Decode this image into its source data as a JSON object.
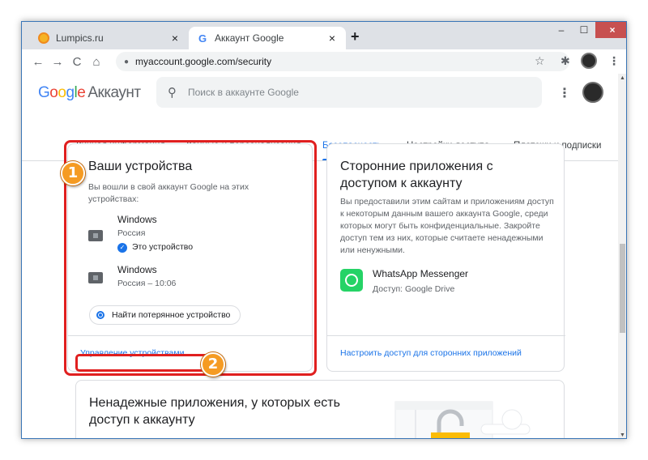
{
  "browser": {
    "tabs": [
      {
        "title": "Lumpics.ru",
        "close": "×"
      },
      {
        "title": "Аккаунт Google",
        "close": "×"
      }
    ],
    "new_tab": "+",
    "window_controls": {
      "minimize": "–",
      "maximize": "☐",
      "close": "×"
    },
    "nav": {
      "back": "←",
      "forward": "→",
      "reload": "C",
      "home": "⌂"
    },
    "url": "myaccount.google.com/security",
    "star": "☆",
    "extensions": "✱",
    "menu": "⋮"
  },
  "header": {
    "logo": {
      "G": "G",
      "o1": "o",
      "o2": "o",
      "g": "g",
      "l": "l",
      "e": "e",
      "suffix": "Аккаунт"
    },
    "search_placeholder": "Поиск в аккаунте Google",
    "apps_menu": "⋮"
  },
  "nav_tabs": [
    "Личная информация",
    "Данные и персонализация",
    "Безопасность",
    "Настройки доступа",
    "Платежи и подписки"
  ],
  "devices_card": {
    "title": "Ваши устройства",
    "description": "Вы вошли в свой аккаунт Google на этих устройствах:",
    "devices": [
      {
        "name": "Windows",
        "location": "Россия",
        "this_device": "Это устройство"
      },
      {
        "name": "Windows",
        "location": "Россия – 10:06"
      }
    ],
    "find_button": "Найти потерянное устройство",
    "manage_link": "Управление устройствами"
  },
  "apps_card": {
    "title_line1": "Сторонние приложения с",
    "title_line2": "доступом к аккаунту",
    "description": "Вы предоставили этим сайтам и приложениям доступ к некоторым данным вашего аккаунта Google, среди которых могут быть конфиденциальные. Закройте доступ тем из них, которые считаете ненадежными или ненужными.",
    "app_name": "WhatsApp Messenger",
    "app_access": "Доступ: Google Drive",
    "manage_link": "Настроить доступ для сторонних приложений"
  },
  "unsafe_card": {
    "title_line1": "Ненадежные приложения, у которых есть",
    "title_line2": "доступ к аккаунту"
  },
  "annotations": {
    "step1": "1",
    "step2": "2"
  },
  "colors": {
    "accent": "#1a73e8",
    "highlight": "#e01f1f",
    "badge": "#f59b23"
  }
}
